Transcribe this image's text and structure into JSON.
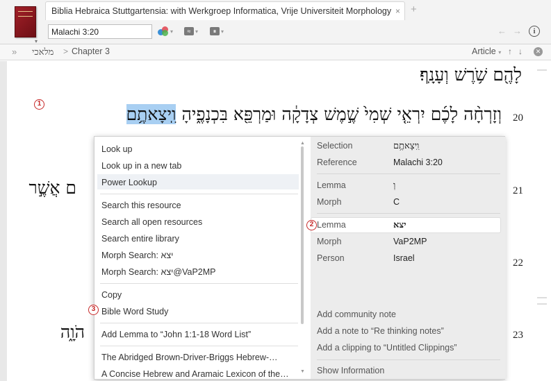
{
  "window": {
    "tab_title": "Biblia Hebraica Stuttgartensia: with Werkgroep Informatica, Vrije Universiteit Morphology",
    "tab_close": "×",
    "tab_add": "+",
    "reference_value": "Malachi 3:20"
  },
  "breadcrumb": {
    "expand": "»",
    "book": "מלאכי",
    "separator": ">",
    "chapter": "Chapter 3",
    "article_label": "Article",
    "dropdown": "▾",
    "up": "↑",
    "down": "↓",
    "close": "✕"
  },
  "text": {
    "line_top": "לָהֶ֖ם שֹׁ֥רֶשׁ וְעָנָֽף׃",
    "verse20_num": "20",
    "verse20": "וְזָרְחָ֨ה לָכֶ֜ם יִרְאֵ֤י שְׁמִי֙ שֶׁ֣מֶשׁ צְדָקָ֔ה וּמַרְפֵּ֖א בִּכְנָפֶ֑יהָ",
    "verse20_selected": "וִֽיצָאתֶ֥ם",
    "verse21_num": "21",
    "verse21_fragment": "ם אֲשֶׁ֣ר",
    "verse22_num": "22",
    "verse23_num": "23",
    "verse23_fragment": "הֹוָ֑ה"
  },
  "callouts": {
    "one": "1",
    "two": "2",
    "three": "3"
  },
  "menu": {
    "items": [
      "Look up",
      "Look up in a new tab",
      "Power Lookup",
      "Search this resource",
      "Search all open resources",
      "Search entire library",
      "Morph Search: יצא",
      "Morph Search: יצא@VaP2MP",
      "Copy",
      "Bible Word Study",
      "Add Lemma to “John 1:1-18 Word List”",
      "The Abridged Brown-Driver-Briggs Hebrew-…",
      "A Concise Hebrew and Aramaic Lexicon of the…"
    ]
  },
  "info": {
    "selection_label": "Selection",
    "selection_value": "וִֽיצָאתֶ֥ם",
    "reference_label": "Reference",
    "reference_value": "Malachi 3:20",
    "lemma1_label": "Lemma",
    "lemma1_value": "וְ",
    "morph1_label": "Morph",
    "morph1_value": "C",
    "lemma2_label": "Lemma",
    "lemma2_value": "יצא",
    "morph2_label": "Morph",
    "morph2_value": "VaP2MP",
    "person_label": "Person",
    "person_value": "Israel",
    "add_community_note": "Add community note",
    "add_note": "Add a note to “Re thinking notes”",
    "add_clipping": "Add a clipping to “Untitled Clippings”",
    "show_information": "Show Information"
  }
}
